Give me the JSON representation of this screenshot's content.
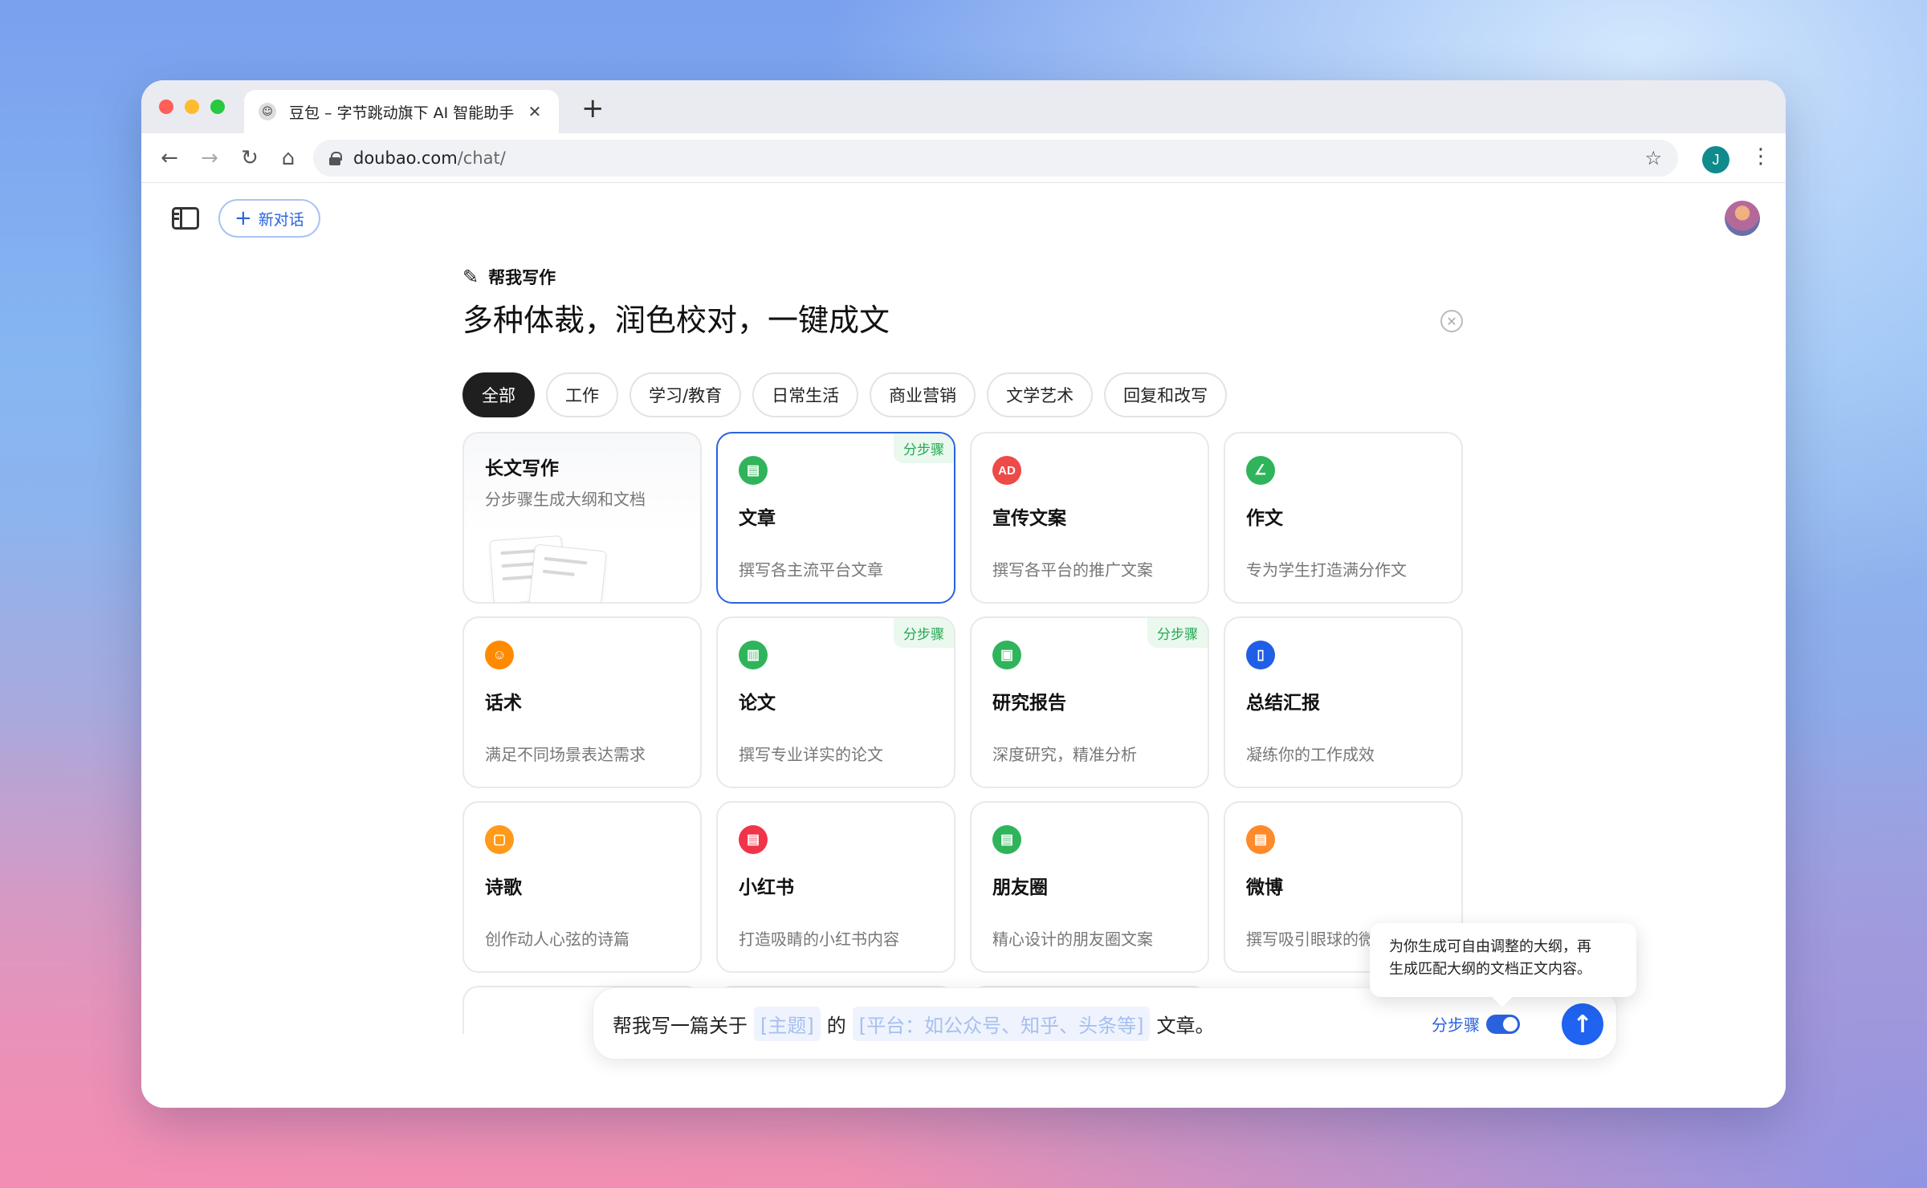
{
  "browser": {
    "tab_title": "豆包 – 字节跳动旗下 AI 智能助手",
    "url_host": "doubao.com",
    "url_path": "/chat/",
    "profile_initial": "J"
  },
  "topbar": {
    "new_chat_label": "新对话"
  },
  "writer": {
    "label": "帮我写作",
    "title": "多种体裁，润色校对，一键成文",
    "categories": [
      "全部",
      "工作",
      "学习/教育",
      "日常生活",
      "商业营销",
      "文学艺术",
      "回复和改写"
    ],
    "active_category": "全部",
    "cards": [
      {
        "title": "长文写作",
        "desc": "分步骤生成大纲和文档"
      },
      {
        "title": "文章",
        "desc": "撰写各主流平台文章",
        "badge": "分步骤",
        "icon": "article-icon",
        "color": "#2fb45b"
      },
      {
        "title": "宣传文案",
        "desc": "撰写各平台的推广文案",
        "icon": "ad-icon",
        "color": "#ee4a48",
        "icon_text": "AD"
      },
      {
        "title": "作文",
        "desc": "专为学生打造满分作文",
        "icon": "pen-icon",
        "color": "#2fb45b"
      },
      {
        "title": "话术",
        "desc": "满足不同场景表达需求",
        "icon": "speech-icon",
        "color": "#ff8a00"
      },
      {
        "title": "论文",
        "desc": "撰写专业详实的论文",
        "badge": "分步骤",
        "icon": "chart-icon",
        "color": "#2fb45b"
      },
      {
        "title": "研究报告",
        "desc": "深度研究，精准分析",
        "badge": "分步骤",
        "icon": "report-icon",
        "color": "#2fb45b"
      },
      {
        "title": "总结汇报",
        "desc": "凝练你的工作成效",
        "icon": "summary-icon",
        "color": "#1f5fe6"
      },
      {
        "title": "诗歌",
        "desc": "创作动人心弦的诗篇",
        "icon": "poem-icon",
        "color": "#ff9a1a"
      },
      {
        "title": "小红书",
        "desc": "打造吸睛的小红书内容",
        "icon": "xiaohongshu-icon",
        "color": "#f0344a"
      },
      {
        "title": "朋友圈",
        "desc": "精心设计的朋友圈文案",
        "icon": "moments-icon",
        "color": "#2fb45b"
      },
      {
        "title": "微博",
        "desc": "撰写吸引眼球的微博",
        "icon": "weibo-icon",
        "color": "#ff8a2a"
      }
    ]
  },
  "tooltip": {
    "line1": "为你生成可自由调整的大纲，再",
    "line2": "生成匹配大纲的文档正文内容。"
  },
  "composer": {
    "prefix": "帮我写一篇关于",
    "slot_topic": "[主题]",
    "middle": "的",
    "slot_platform": "[平台：如公众号、知乎、头条等]",
    "suffix": "文章。",
    "step_label": "分步骤"
  }
}
